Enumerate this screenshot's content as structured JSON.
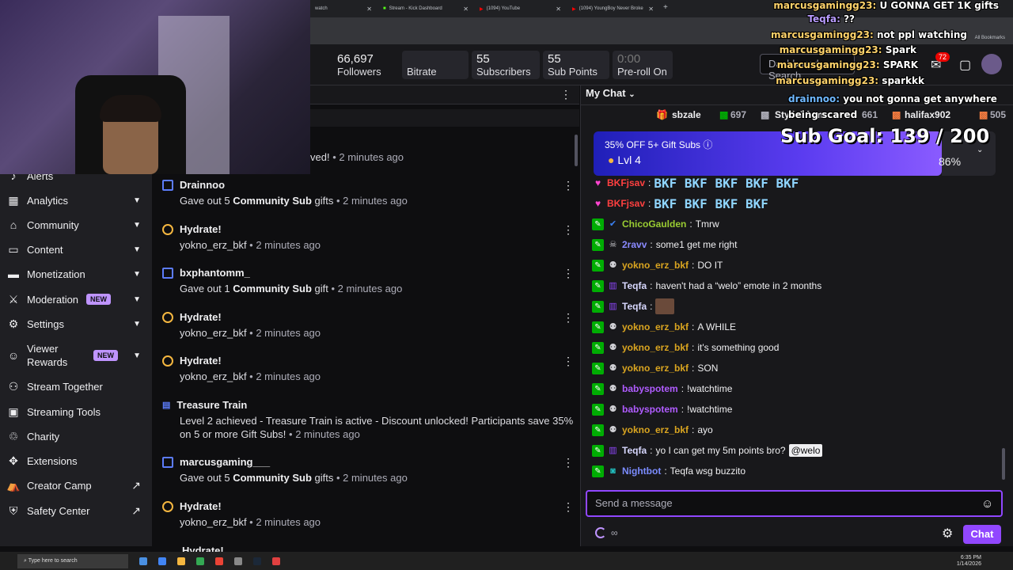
{
  "browser": {
    "tabs": [
      {
        "label": "watch"
      },
      {
        "label": "Stream - Kick Dashboard"
      },
      {
        "label": "(1094) YouTube"
      },
      {
        "label": "(1094) YoungBoy Never Broke"
      }
    ],
    "bookmarks_label": "All Bookmarks"
  },
  "stats": [
    {
      "value": "66,697",
      "label": "Followers"
    },
    {
      "value": "",
      "label": "Bitrate"
    },
    {
      "value": "55",
      "label": "Subscribers"
    },
    {
      "value": "55",
      "label": "Sub Points"
    },
    {
      "value": "0:00",
      "label": "Pre-roll On"
    }
  ],
  "header": {
    "dashboard_search": "Dashboard Search",
    "notif_count": "72"
  },
  "nav": {
    "items": [
      {
        "label": "Alerts",
        "icon": "bell-icon"
      },
      {
        "label": "Analytics",
        "icon": "chart-icon"
      },
      {
        "label": "Community",
        "icon": "community-icon"
      },
      {
        "label": "Content",
        "icon": "content-icon"
      },
      {
        "label": "Monetization",
        "icon": "money-icon"
      },
      {
        "label": "Moderation",
        "icon": "sword-icon",
        "badge": "NEW"
      },
      {
        "label": "Settings",
        "icon": "gear-icon"
      },
      {
        "label": "Viewer Rewards",
        "icon": "smile-icon",
        "badge": "NEW"
      },
      {
        "label": "Stream Together",
        "icon": "people-icon"
      },
      {
        "label": "Streaming Tools",
        "icon": "camera-icon"
      },
      {
        "label": "Charity",
        "icon": "charity-icon"
      },
      {
        "label": "Extensions",
        "icon": "puzzle-icon"
      },
      {
        "label": "Creator Camp",
        "icon": "camp-icon"
      },
      {
        "label": "Safety Center",
        "icon": "shield-icon"
      }
    ]
  },
  "feed": {
    "partial_top": "ved!",
    "partial_top_time": "2 minutes ago",
    "items": [
      {
        "title": "Drainnoo",
        "pre": "Gave out 5 ",
        "bold": "Community Sub",
        "post": " gifts",
        "time": "2 minutes ago",
        "type": "gift"
      },
      {
        "title": "Hydrate!",
        "pre": "yokno_erz_bkf",
        "bold": "",
        "post": "",
        "time": "2 minutes ago",
        "type": "hydrate"
      },
      {
        "title": "bxphantomm_",
        "pre": "Gave out 1 ",
        "bold": "Community Sub",
        "post": " gift",
        "time": "2 minutes ago",
        "type": "gift"
      },
      {
        "title": "Hydrate!",
        "pre": "yokno_erz_bkf",
        "bold": "",
        "post": "",
        "time": "2 minutes ago",
        "type": "hydrate"
      },
      {
        "title": "Hydrate!",
        "pre": "yokno_erz_bkf",
        "bold": "",
        "post": "",
        "time": "2 minutes ago",
        "type": "hydrate"
      },
      {
        "title": "Treasure Train",
        "pre": "Level 2 achieved - Treasure Train is active - Discount unlocked! Participants save 35% on 5 or more Gift Subs!",
        "bold": "",
        "post": "",
        "time": "2 minutes ago",
        "type": "train"
      },
      {
        "title": "marcusgaming___",
        "pre": "Gave out 5 ",
        "bold": "Community Sub",
        "post": " gifts",
        "time": "2 minutes ago",
        "type": "gift"
      },
      {
        "title": "Hydrate!",
        "pre": "yokno_erz_bkf",
        "bold": "",
        "post": "",
        "time": "2 minutes ago",
        "type": "hydrate"
      }
    ],
    "partial_bottom": "Hydrate!",
    "separator": " • "
  },
  "chat": {
    "title": "My Chat",
    "gifters": [
      {
        "name": "sbzale",
        "count": ""
      },
      {
        "name": "",
        "count": "697"
      },
      {
        "name": "Stylishfame",
        "count": ""
      },
      {
        "name": "",
        "count": "661"
      },
      {
        "name": "halifax902",
        "count": ""
      },
      {
        "name": "",
        "count": "505"
      }
    ],
    "banner_offer": "35% OFF 5+ Gift Subs",
    "banner_level": "Lvl 4",
    "banner_pct": "86%",
    "sub_goal": "Sub Goal:  139 / 200",
    "messages": [
      {
        "user": "BKFjsav",
        "color": "#ff4040",
        "text": "BKF BKF BKF BKF BKF",
        "badge": "heart",
        "emote": true
      },
      {
        "user": "BKFjsav",
        "color": "#ff4040",
        "text": "BKF BKF BKF BKF",
        "badge": "heart",
        "emote": true
      },
      {
        "user": "ChicoGaulden",
        "color": "#9acd32",
        "text": "Tmrw",
        "badge": "mod"
      },
      {
        "user": "2ravv",
        "color": "#8a8aff",
        "text": "some1 get me right",
        "badge": "mod"
      },
      {
        "user": "yokno_erz_bkf",
        "color": "#daa520",
        "text": "DO IT",
        "badge": "mod"
      },
      {
        "user": "Teqfa",
        "color": "#d8d8ff",
        "text": "haven't had a “welo” emote in 2 months",
        "badge": "mod"
      },
      {
        "user": "Teqfa",
        "color": "#d8d8ff",
        "text": "",
        "badge": "mod",
        "img": true
      },
      {
        "user": "yokno_erz_bkf",
        "color": "#daa520",
        "text": "A WHILE",
        "badge": "mod"
      },
      {
        "user": "yokno_erz_bkf",
        "color": "#daa520",
        "text": "it's something good",
        "badge": "mod"
      },
      {
        "user": "yokno_erz_bkf",
        "color": "#daa520",
        "text": "SON",
        "badge": "mod"
      },
      {
        "user": "babyspotem",
        "color": "#b05cff",
        "text": "!watchtime",
        "badge": "mod"
      },
      {
        "user": "babyspotem",
        "color": "#b05cff",
        "text": "!watchtime",
        "badge": "mod"
      },
      {
        "user": "yokno_erz_bkf",
        "color": "#daa520",
        "text": "ayo",
        "badge": "mod"
      },
      {
        "user": "Teqfa",
        "color": "#d8d8ff",
        "text": "yo I can get my 5m points bro?",
        "badge": "mod",
        "mention": "@welo"
      },
      {
        "user": "Nightbot",
        "color": "#7b8cff",
        "text": "Teqfa wsg buzzito",
        "badge": "mod"
      }
    ],
    "input_placeholder": "Send a message",
    "chat_button": "Chat",
    "points_symbol": "∞"
  },
  "overlay_chat": [
    {
      "user": "marcusgamingg23:",
      "text": "U GONNA GET 1K gifts"
    },
    {
      "user": "Teqfa:",
      "text": "??"
    },
    {
      "user": "marcusgamingg23:",
      "text": "not ppl watching"
    },
    {
      "user": "marcusgamingg23:",
      "text": "Spark"
    },
    {
      "user": "marcusgamingg23:",
      "text": "SPARK"
    },
    {
      "user": "marcusgamingg23:",
      "text": "sparkkk"
    },
    {
      "user": "drainnoo:",
      "text": "you not gonna get anywhere being scared"
    }
  ],
  "taskbar": {
    "search": "Type here to search",
    "time": "6:35 PM",
    "date": "1/14/2026"
  },
  "colors": {
    "accent": "#9147ff",
    "mod_green": "#00ad03",
    "new_badge": "#bf94ff"
  }
}
